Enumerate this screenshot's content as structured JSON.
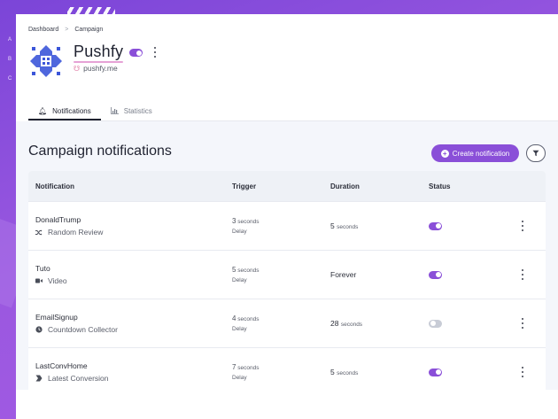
{
  "colors": {
    "accent": "#8a4fd8",
    "background": "#8e4fd6",
    "toggle_off": "#c8ccd6"
  },
  "breadcrumb": {
    "items": [
      "Dashboard",
      "Campaign"
    ],
    "separator": ">"
  },
  "campaign": {
    "name": "Pushfy",
    "domain": "pushfy.me",
    "enabled": true
  },
  "tabs": [
    {
      "label": "Notifications",
      "icon": "bell-icon",
      "active": true
    },
    {
      "label": "Statistics",
      "icon": "bar-chart-icon",
      "active": false
    }
  ],
  "main": {
    "title": "Campaign notifications",
    "create_label": "Create notification"
  },
  "table": {
    "headers": {
      "notification": "Notification",
      "trigger": "Trigger",
      "duration": "Duration",
      "status": "Status"
    },
    "rows": [
      {
        "name": "DonaldTrump",
        "type": "Random Review",
        "type_icon": "shuffle-icon",
        "trigger_value": "3",
        "trigger_unit": "seconds",
        "trigger_label": "Delay",
        "duration_value": "5",
        "duration_unit": "seconds",
        "status": true
      },
      {
        "name": "Tuto",
        "type": "Video",
        "type_icon": "video-icon",
        "trigger_value": "5",
        "trigger_unit": "seconds",
        "trigger_label": "Delay",
        "duration_value": "Forever",
        "duration_unit": "",
        "status": true
      },
      {
        "name": "EmailSignup",
        "type": "Countdown Collector",
        "type_icon": "clock-icon",
        "trigger_value": "4",
        "trigger_unit": "seconds",
        "trigger_label": "Delay",
        "duration_value": "28",
        "duration_unit": "seconds",
        "status": false
      },
      {
        "name": "LastConvHome",
        "type": "Latest Conversion",
        "type_icon": "conversion-icon",
        "trigger_value": "7",
        "trigger_unit": "seconds",
        "trigger_label": "Delay",
        "duration_value": "5",
        "duration_unit": "seconds",
        "status": true
      }
    ]
  }
}
